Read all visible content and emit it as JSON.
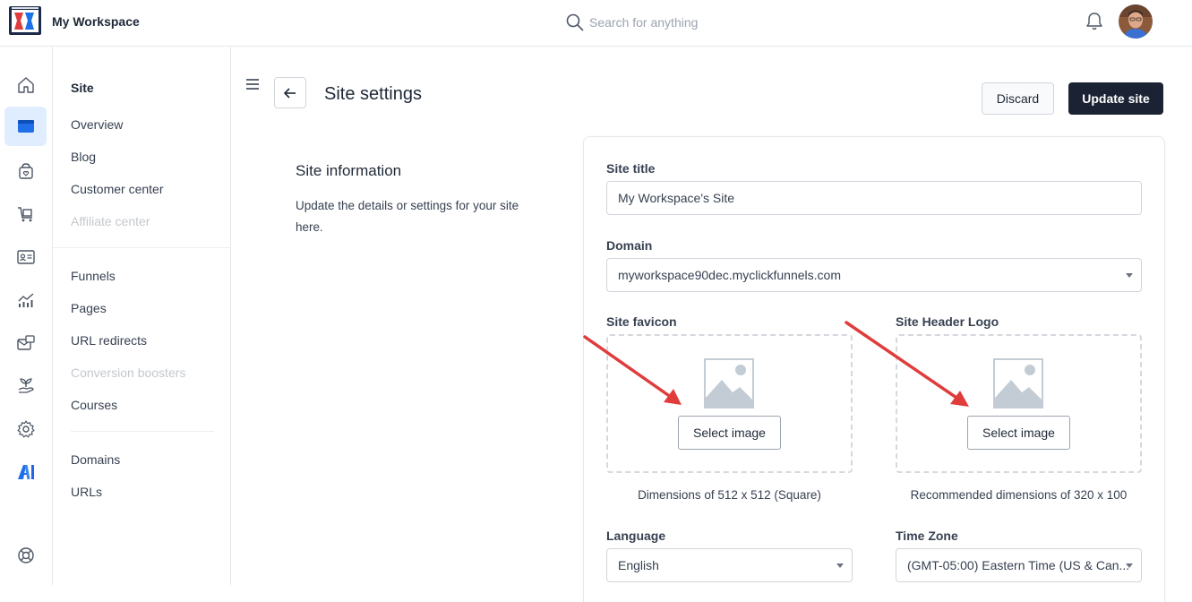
{
  "topbar": {
    "workspace_name": "My Workspace",
    "search_placeholder": "Search for anything"
  },
  "rail": {
    "items": [
      "home-icon",
      "site-icon",
      "store-icon",
      "cart-icon",
      "contacts-icon",
      "analytics-icon",
      "email-icon",
      "plant-icon",
      "settings-icon",
      "ai-icon",
      "help-icon"
    ],
    "active": "site-icon"
  },
  "subnav": {
    "heading": "Site",
    "group1": [
      "Overview",
      "Blog",
      "Customer center",
      "Affiliate center"
    ],
    "group2": [
      "Funnels",
      "Pages",
      "URL redirects",
      "Conversion boosters",
      "Courses"
    ],
    "group3": [
      "Domains",
      "URLs"
    ],
    "disabled": [
      "Affiliate center",
      "Conversion boosters"
    ]
  },
  "header": {
    "title": "Site settings",
    "discard_label": "Discard",
    "update_label": "Update site"
  },
  "section": {
    "title": "Site information",
    "description": "Update the details or settings for your site here."
  },
  "form": {
    "site_title_label": "Site title",
    "site_title_value": "My Workspace's Site",
    "domain_label": "Domain",
    "domain_value": "myworkspace90dec.myclickfunnels.com",
    "favicon_label": "Site favicon",
    "favicon_button": "Select image",
    "favicon_hint": "Dimensions of 512 x 512 (Square)",
    "logo_label": "Site Header Logo",
    "logo_button": "Select image",
    "logo_hint": "Recommended dimensions of 320 x 100",
    "language_label": "Language",
    "language_value": "English",
    "timezone_label": "Time Zone",
    "timezone_value": "(GMT-05:00) Eastern Time (US & Can..."
  },
  "colors": {
    "primary_dark": "#1a2233",
    "active_rail": "#e0edff",
    "accent_blue": "#1e6fe8",
    "annotation_red": "#e03c3c"
  }
}
